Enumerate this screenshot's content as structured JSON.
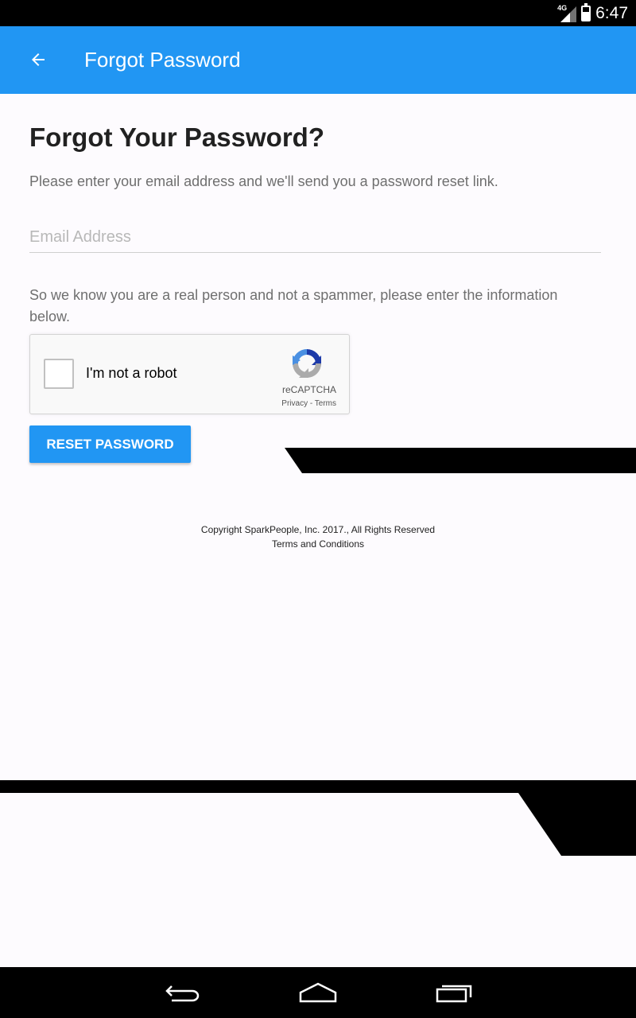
{
  "status_bar": {
    "network": "4G",
    "time": "6:47"
  },
  "app_bar": {
    "title": "Forgot Password",
    "back_icon": "arrow-left-icon"
  },
  "main": {
    "heading": "Forgot Your Password?",
    "intro": "Please enter your email address and we'll send you a password reset link.",
    "email_placeholder": "Email Address",
    "email_value": "",
    "spam_notice": "So we know you are a real person and not a spammer, please enter the information below.",
    "recaptcha": {
      "label": "I'm not a robot",
      "brand": "reCAPTCHA",
      "links": "Privacy - Terms",
      "checked": false
    },
    "reset_button": "RESET PASSWORD"
  },
  "footer": {
    "copyright": "Copyright SparkPeople, Inc. 2017., All Rights Reserved",
    "terms": "Terms and Conditions"
  },
  "nav_bar": {
    "back_icon": "nav-back-icon",
    "home_icon": "nav-home-icon",
    "recents_icon": "nav-recents-icon"
  },
  "colors": {
    "primary": "#2196f3",
    "heading": "#212121",
    "muted_text": "#6f6f6f",
    "background": "#fdfbfe"
  }
}
